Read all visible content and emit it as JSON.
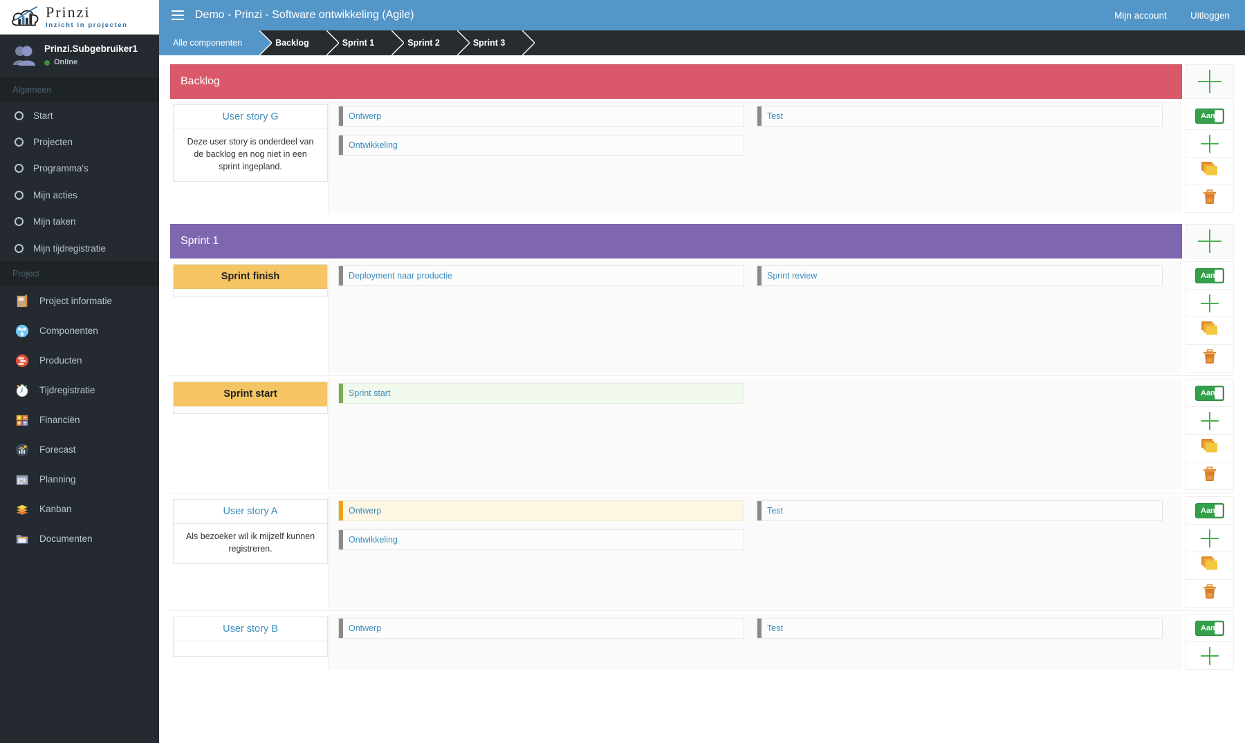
{
  "brand": {
    "name": "Prinzi",
    "tagline": "Inzicht in projecten",
    "logo_icon": "cloud-bar-chart-logo"
  },
  "user": {
    "name": "Prinzi.Subgebruiker1",
    "status": "Online",
    "status_color": "#3c8f40",
    "avatar_icon": "users-avatar-icon"
  },
  "sidebar": {
    "general_header": "Algemeen",
    "general_items": [
      {
        "label": "Start",
        "icon": "circle-icon"
      },
      {
        "label": "Projecten",
        "icon": "circle-icon"
      },
      {
        "label": "Programma's",
        "icon": "circle-icon"
      },
      {
        "label": "Mijn acties",
        "icon": "circle-icon"
      },
      {
        "label": "Mijn taken",
        "icon": "circle-icon"
      },
      {
        "label": "Mijn tijdregistratie",
        "icon": "circle-icon"
      }
    ],
    "project_header": "Project",
    "project_items": [
      {
        "label": "Project informatie",
        "icon": "notebook-icon",
        "glyph": "📔"
      },
      {
        "label": "Componenten",
        "icon": "components-icon",
        "glyph": "⚙"
      },
      {
        "label": "Producten",
        "icon": "products-icon",
        "glyph": "☰"
      },
      {
        "label": "Tijdregistratie",
        "icon": "stopwatch-icon",
        "glyph": "⏱"
      },
      {
        "label": "Financiën",
        "icon": "calculator-icon",
        "glyph": "🧮"
      },
      {
        "label": "Forecast",
        "icon": "chart-up-icon",
        "glyph": "📊"
      },
      {
        "label": "Planning",
        "icon": "calendar-icon",
        "glyph": "📅"
      },
      {
        "label": "Kanban",
        "icon": "layers-icon",
        "glyph": "◆"
      },
      {
        "label": "Documenten",
        "icon": "folder-icon",
        "glyph": "📁"
      }
    ]
  },
  "topbar": {
    "menu_icon": "hamburger-menu-icon",
    "title": "Demo - Prinzi - Software ontwikkeling (Agile)",
    "account_link": "Mijn account",
    "logout_link": "Uitloggen",
    "background": "#5596c8"
  },
  "breadcrumb": {
    "items": [
      {
        "label": "Alle componenten",
        "active": true
      },
      {
        "label": "Backlog",
        "active": false
      },
      {
        "label": "Sprint 1",
        "active": false
      },
      {
        "label": "Sprint 2",
        "active": false
      },
      {
        "label": "Sprint 3",
        "active": false
      }
    ]
  },
  "actions": {
    "toggle_label": "Aan",
    "add_icon": "plus-icon",
    "copy_icon": "copy-cards-icon",
    "delete_icon": "trash-icon",
    "section_add_icon": "plus-icon"
  },
  "board": {
    "sections": [
      {
        "title": "Backlog",
        "color": "#d9596a",
        "rows": [
          {
            "card_title": "User story G",
            "card_title_style": "link",
            "card_body": "Deze user story is onderdeel van de backlog en nog niet in een sprint ingepland.",
            "tasks_left": [
              {
                "label": "Ontwerp",
                "state": "default"
              },
              {
                "label": "Ontwikkeling",
                "state": "default"
              }
            ],
            "tasks_right": [
              {
                "label": "Test",
                "state": "default"
              }
            ]
          }
        ]
      },
      {
        "title": "Sprint 1",
        "color": "#7f67b0",
        "rows": [
          {
            "card_title": "Sprint finish",
            "card_title_style": "milestone",
            "card_body": "",
            "tasks_left": [
              {
                "label": "Deployment naar productie",
                "state": "default"
              }
            ],
            "tasks_right": [
              {
                "label": "Sprint review",
                "state": "default"
              }
            ]
          },
          {
            "card_title": "Sprint start",
            "card_title_style": "milestone",
            "card_body": "",
            "tasks_left": [
              {
                "label": "Sprint start",
                "state": "green"
              }
            ],
            "tasks_right": []
          },
          {
            "card_title": "User story A",
            "card_title_style": "link",
            "card_body": "Als bezoeker wil ik mijzelf kunnen registreren.",
            "tasks_left": [
              {
                "label": "Ontwerp",
                "state": "orange"
              },
              {
                "label": "Ontwikkeling",
                "state": "default"
              }
            ],
            "tasks_right": [
              {
                "label": "Test",
                "state": "default"
              }
            ]
          },
          {
            "card_title": "User story B",
            "card_title_style": "link",
            "card_body": "",
            "tasks_left": [
              {
                "label": "Ontwerp",
                "state": "default"
              }
            ],
            "tasks_right": [
              {
                "label": "Test",
                "state": "default"
              }
            ]
          }
        ]
      }
    ]
  }
}
